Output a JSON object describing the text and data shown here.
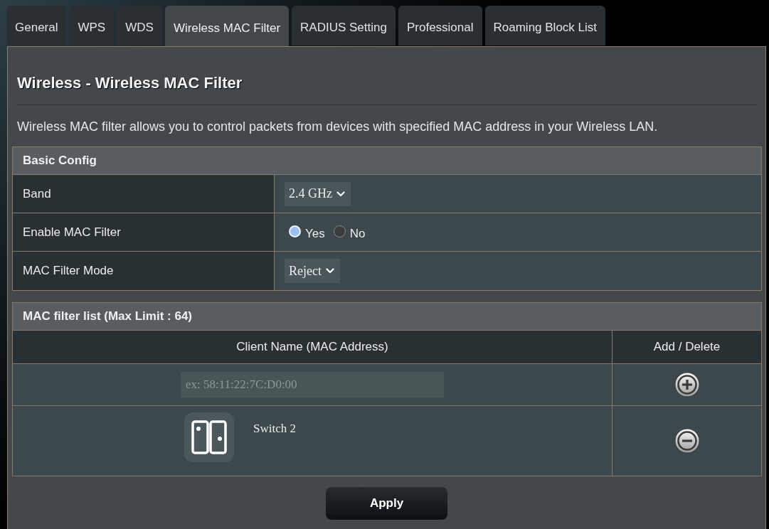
{
  "tabs": [
    {
      "label": "General",
      "selected": false
    },
    {
      "label": "WPS",
      "selected": false
    },
    {
      "label": "WDS",
      "selected": false
    },
    {
      "label": "Wireless MAC Filter",
      "selected": true
    },
    {
      "label": "RADIUS Setting",
      "selected": false
    },
    {
      "label": "Professional",
      "selected": false
    },
    {
      "label": "Roaming Block List",
      "selected": false
    }
  ],
  "page_title": "Wireless - Wireless MAC Filter",
  "description": "Wireless MAC filter allows you to control packets from devices with specified MAC address in your Wireless LAN.",
  "basic_config": {
    "title": "Basic Config",
    "rows": [
      {
        "kind": "select",
        "label": "Band",
        "value": "2.4 GHz"
      },
      {
        "kind": "radio",
        "label": "Enable MAC Filter",
        "options": [
          {
            "label": "Yes",
            "selected": true
          },
          {
            "label": "No",
            "selected": false
          }
        ]
      },
      {
        "kind": "select",
        "label": "MAC Filter Mode",
        "value": "Reject"
      }
    ]
  },
  "mac_filter_list": {
    "title": "MAC filter list (Max Limit : 64)",
    "columns": [
      "Client Name (MAC Address)",
      "Add / Delete"
    ],
    "rows": [
      {
        "kind": "input",
        "placeholder": "ex: 58:11:22:7C:D0:00"
      },
      {
        "kind": "device",
        "name": "Switch 2"
      }
    ]
  },
  "apply_button": {
    "label": "Apply"
  }
}
